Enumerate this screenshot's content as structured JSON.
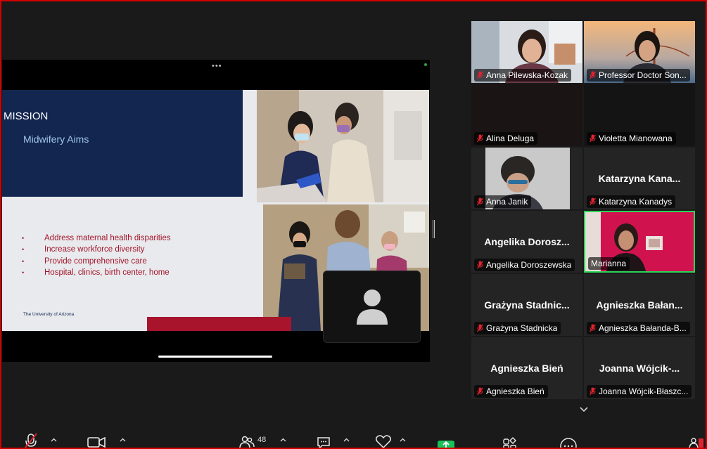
{
  "share": {
    "dots": "•••",
    "slide": {
      "title": "MISSION",
      "subtitle": "Midwifery Aims",
      "bullets": [
        "Address maternal health disparities",
        "Increase workforce diversity",
        "Provide comprehensive care",
        "Hospital, clinics, birth center, home"
      ],
      "bullet_glyph": "•",
      "footer": "The University of Arizona"
    }
  },
  "gallery": {
    "tiles": [
      {
        "name": "Anna Pilewska-Kozak",
        "big": "",
        "video": "photo-room"
      },
      {
        "name": "Professor Doctor Son...",
        "big": "",
        "video": "photo-bridge"
      },
      {
        "name": "Alina Deluga",
        "big": "",
        "video": "dark"
      },
      {
        "name": "Violetta Mianowana",
        "big": "",
        "video": "dark"
      },
      {
        "name": "Anna Janik",
        "big": "",
        "video": "photo-janik"
      },
      {
        "name": "Katarzyna Kanadys",
        "big": "Katarzyna  Kana...",
        "video": "none"
      },
      {
        "name": "Angelika Doroszewska",
        "big": "Angelika  Dorosz...",
        "video": "none"
      },
      {
        "name": "Marianna",
        "big": "",
        "video": "photo-pink",
        "active": true
      },
      {
        "name": "Grażyna Stadnicka",
        "big": "Grażyna  Stadnic...",
        "video": "none"
      },
      {
        "name": "Agnieszka Bałanda-B...",
        "big": "Agnieszka  Bałan...",
        "video": "none"
      },
      {
        "name": "Agnieszka Bień",
        "big": "Agnieszka  Bień",
        "video": "none"
      },
      {
        "name": "Joanna Wójcik-Błaszc...",
        "big": "Joanna  Wójcik-...",
        "video": "none"
      }
    ]
  },
  "toolbar": {
    "participants_count": "48"
  },
  "colors": {
    "slide_navy": "#132650",
    "slide_red": "#a8142b",
    "active_speaker": "#2fd35a",
    "share_green": "#19c15a",
    "mic_off_red": "#e0242f"
  }
}
